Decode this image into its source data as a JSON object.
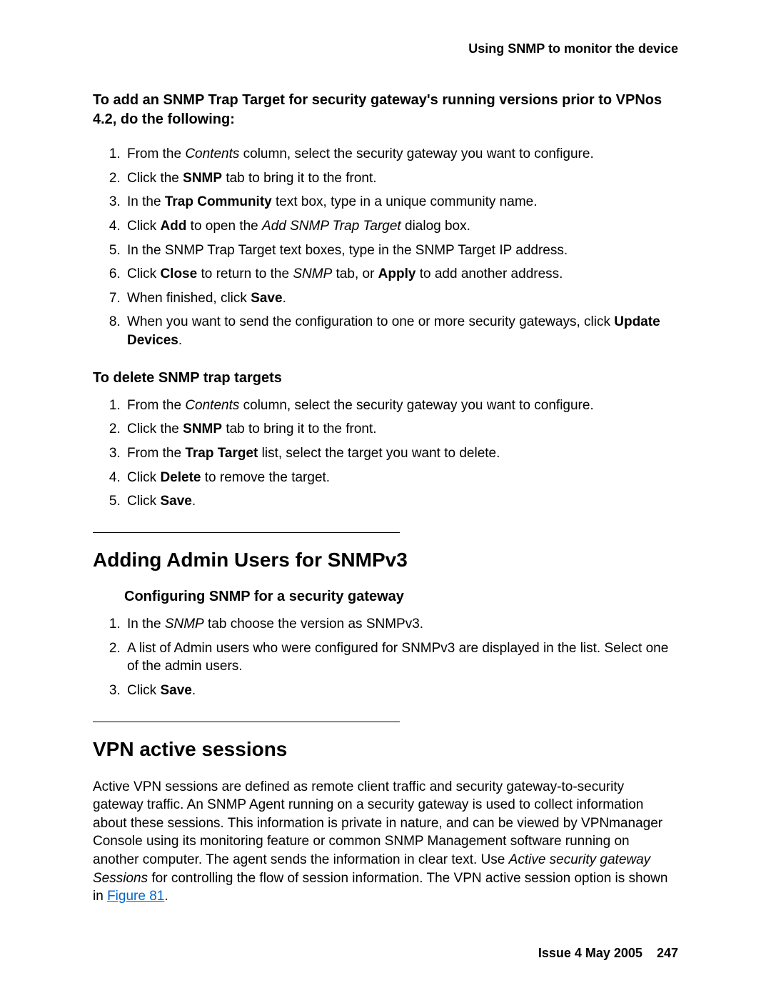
{
  "running_head": "Using SNMP to monitor the device",
  "section_a": {
    "title": "To add an SNMP Trap Target for security gateway's running versions prior to VPNos 4.2, do the following:",
    "steps": [
      {
        "pre": "From the ",
        "em": "Contents",
        "post": " column, select the security gateway you want to configure."
      },
      {
        "pre": "Click the ",
        "b1": "SNMP",
        "post": " tab to bring it to the front."
      },
      {
        "pre": "In the ",
        "b1": "Trap Community",
        "post": " text box, type in a unique community name."
      },
      {
        "pre": "Click ",
        "b1": "Add",
        "mid": " to open the ",
        "em": "Add SNMP Trap Target",
        "post": " dialog box."
      },
      {
        "pre": "In the SNMP Trap Target text boxes, type in the SNMP Target IP address."
      },
      {
        "pre": "Click ",
        "b1": "Close",
        "mid": " to return to the ",
        "em": "SNMP",
        "mid2": " tab, or ",
        "b2": "Apply",
        "post": " to add another address."
      },
      {
        "pre": "When finished, click ",
        "b1": "Save",
        "post": "."
      },
      {
        "pre": "When you want to send the configuration to one or more security gateways, click ",
        "b1": "Update Devices",
        "post": "."
      }
    ]
  },
  "section_b": {
    "title": "To delete SNMP trap targets",
    "steps": [
      {
        "pre": "From the ",
        "em": "Contents",
        "post": " column, select the security gateway you want to configure."
      },
      {
        "pre": "Click the ",
        "b1": "SNMP",
        "post": " tab to bring it to the front."
      },
      {
        "pre": "From the ",
        "b1": "Trap Target",
        "post": " list, select the target you want to delete."
      },
      {
        "pre": "Click ",
        "b1": "Delete",
        "post": " to remove the target."
      },
      {
        "pre": "Click ",
        "b1": "Save",
        "post": "."
      }
    ]
  },
  "section_c": {
    "heading": "Adding Admin Users for SNMPv3",
    "sub": "Configuring SNMP for a security gateway",
    "steps": [
      {
        "pre": "In the ",
        "em": "SNMP",
        "post": " tab choose the version as SNMPv3."
      },
      {
        "pre": "A list of Admin users who were configured for SNMPv3 are displayed in the list. Select one of the admin users."
      },
      {
        "pre": "Click ",
        "b1": "Save",
        "post": "."
      }
    ]
  },
  "section_d": {
    "heading": "VPN active sessions",
    "para_pre": "Active VPN sessions are defined as remote client traffic and security gateway-to-security gateway traffic. An SNMP Agent running on a security gateway is used to collect information about these sessions. This information is private in nature, and can be viewed by VPNmanager Console using its monitoring feature or common SNMP Management software running on another computer. The agent sends the information in clear text. Use ",
    "para_em": "Active security gateway Sessions",
    "para_mid": " for controlling the flow of session information. The VPN active session option is shown in ",
    "link_text": "Figure 81",
    "para_post": "."
  },
  "footer": {
    "issue": "Issue 4   May 2005",
    "page": "247"
  }
}
